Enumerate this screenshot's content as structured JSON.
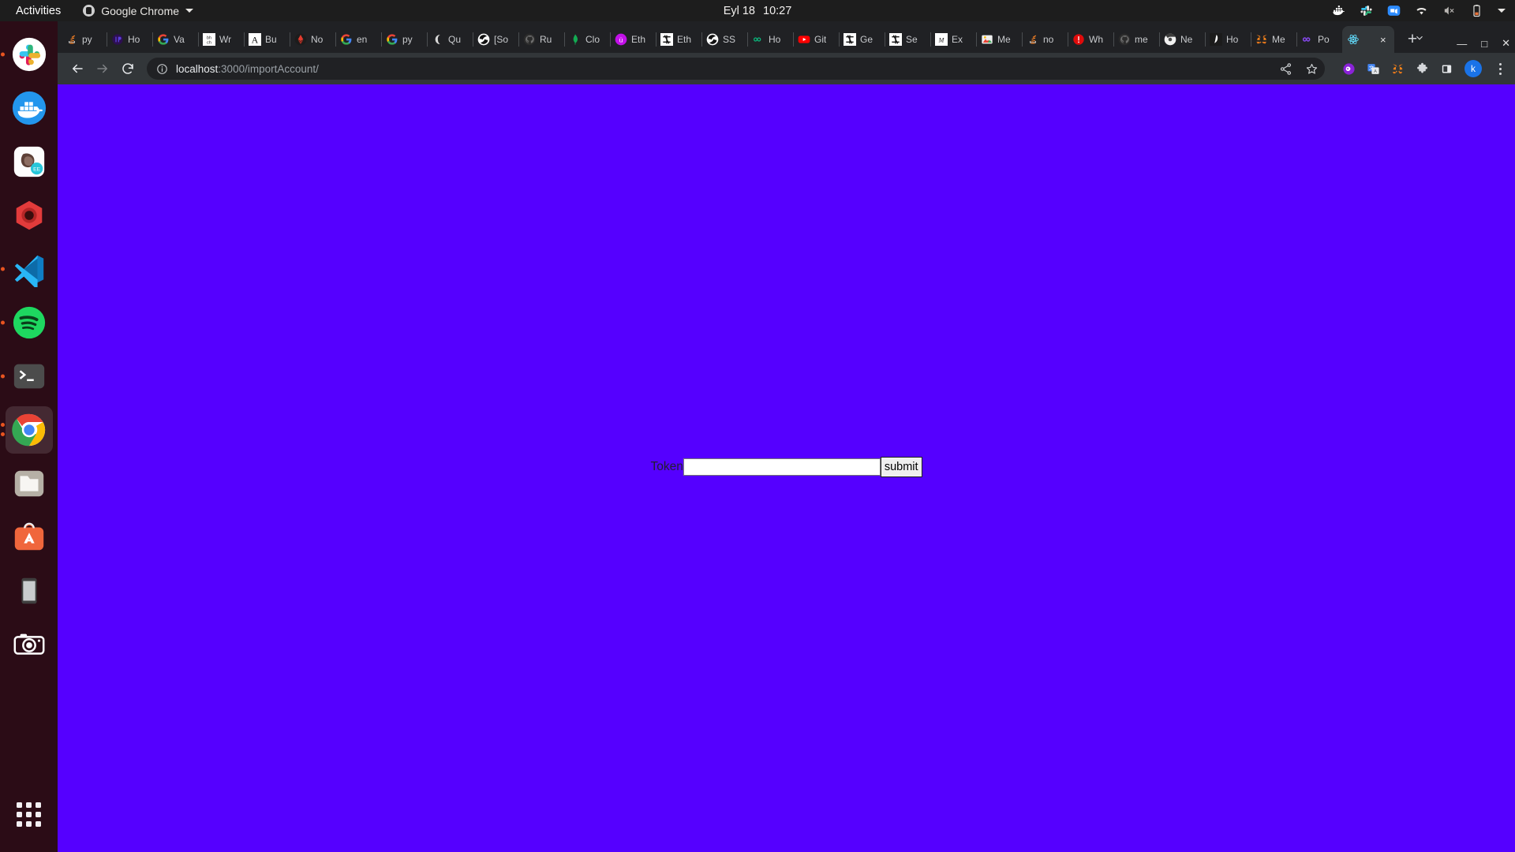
{
  "desktop": {
    "activities_label": "Activities",
    "app_menu_label": "Google Chrome",
    "app_menu_icon": "chrome-icon",
    "clock_date": "Eyl 18",
    "clock_time": "10:27",
    "tray_icons": [
      "docker-icon",
      "slack-icon",
      "zoom-icon",
      "wifi-icon",
      "volume-muted-icon",
      "battery-low-icon",
      "chevron-down-icon"
    ],
    "dock_items": [
      {
        "name": "slack",
        "icon": "slack-icon",
        "running": true,
        "active": false
      },
      {
        "name": "docker",
        "icon": "docker-icon",
        "running": false,
        "active": false
      },
      {
        "name": "datagrip",
        "icon": "datagrip-beaver-icon",
        "running": false,
        "active": false
      },
      {
        "name": "rubymine",
        "icon": "red-hexagon-icon",
        "running": false,
        "active": false
      },
      {
        "name": "vscode",
        "icon": "vscode-icon",
        "running": true,
        "active": false
      },
      {
        "name": "spotify",
        "icon": "spotify-icon",
        "running": true,
        "active": false
      },
      {
        "name": "terminal",
        "icon": "terminal-icon",
        "running": true,
        "active": false
      },
      {
        "name": "google-chrome",
        "icon": "chrome-icon",
        "running": true,
        "active": true
      },
      {
        "name": "files",
        "icon": "folder-icon",
        "running": false,
        "active": false
      },
      {
        "name": "ubuntu-software",
        "icon": "ubuntu-software-icon",
        "running": false,
        "active": false
      },
      {
        "name": "device",
        "icon": "tablet-icon",
        "running": false,
        "active": false
      },
      {
        "name": "screenshot",
        "icon": "camera-icon",
        "running": false,
        "active": false
      }
    ],
    "show_applications_label": "Show Applications"
  },
  "browser": {
    "tabs": [
      {
        "label": "py",
        "icon": "stackoverflow-icon",
        "active": false
      },
      {
        "label": "Ho",
        "icon": "invision-icon",
        "active": false
      },
      {
        "label": "Va",
        "icon": "google-icon",
        "active": false
      },
      {
        "label": "Wr",
        "icon": "bhch-icon",
        "active": false
      },
      {
        "label": "Bu",
        "icon": "letter-a-icon",
        "active": false
      },
      {
        "label": "No",
        "icon": "ethereum-red-icon",
        "active": false
      },
      {
        "label": "en",
        "icon": "google-icon",
        "active": false
      },
      {
        "label": "py",
        "icon": "google-icon",
        "active": false
      },
      {
        "label": "Qu",
        "icon": "moon-icon",
        "active": false
      },
      {
        "label": "[So",
        "icon": "stackexchange-icon",
        "active": false
      },
      {
        "label": "Ru",
        "icon": "github-icon",
        "active": false
      },
      {
        "label": "Clo",
        "icon": "mongodb-icon",
        "active": false
      },
      {
        "label": "Eth",
        "icon": "purple-u-icon",
        "active": false
      },
      {
        "label": "Eth",
        "icon": "ethereum-icon",
        "active": false
      },
      {
        "label": "SS",
        "icon": "stackexchange-icon",
        "active": false
      },
      {
        "label": "Ho",
        "icon": "green-infinity-icon",
        "active": false
      },
      {
        "label": "Git",
        "icon": "youtube-icon",
        "active": false
      },
      {
        "label": "Ge",
        "icon": "ethereum-icon",
        "active": false
      },
      {
        "label": "Se",
        "icon": "ethereum-icon",
        "active": false
      },
      {
        "label": "Ex",
        "icon": "medium-icon",
        "active": false
      },
      {
        "label": "Me",
        "icon": "photos-icon",
        "active": false
      },
      {
        "label": "no",
        "icon": "stackoverflow-icon",
        "active": false
      },
      {
        "label": "Wh",
        "icon": "alert-icon",
        "active": false
      },
      {
        "label": "me",
        "icon": "github-icon",
        "active": false
      },
      {
        "label": "Ne",
        "icon": "chrome-icon",
        "active": false
      },
      {
        "label": "Ho",
        "icon": "feather-icon",
        "active": false
      },
      {
        "label": "Me",
        "icon": "metamask-fox-icon",
        "active": false
      },
      {
        "label": "Po",
        "icon": "polygon-icon",
        "active": false
      },
      {
        "label": "",
        "icon": "react-icon",
        "active": true
      }
    ],
    "tab_close_label": "×",
    "new_tab_label": "+",
    "tab_search_icon": "chevron-down-icon",
    "window_controls": {
      "minimize": "—",
      "maximize": "□",
      "close": "✕"
    },
    "nav": {
      "back_icon": "arrow-left-icon",
      "forward_icon": "arrow-right-icon",
      "reload_icon": "reload-icon"
    },
    "omnibox": {
      "security_icon": "info-circle-icon",
      "url_host": "localhost",
      "url_path": ":3000/importAccount/",
      "share_icon": "share-icon",
      "bookmark_icon": "star-icon"
    },
    "extensions": [
      {
        "name": "ghost-extension",
        "icon": "purple-ghost-icon"
      },
      {
        "name": "google-translate",
        "icon": "translate-icon"
      },
      {
        "name": "metamask",
        "icon": "metamask-fox-icon"
      },
      {
        "name": "extensions-menu",
        "icon": "puzzle-icon"
      },
      {
        "name": "side-panel",
        "icon": "side-panel-icon"
      }
    ],
    "profile_initial": "k",
    "menu_icon": "three-dot-menu-icon"
  },
  "page": {
    "background_color": "#5500ff",
    "form": {
      "token_label": "Token",
      "token_value": "",
      "token_placeholder": "",
      "submit_label": "submit"
    }
  }
}
